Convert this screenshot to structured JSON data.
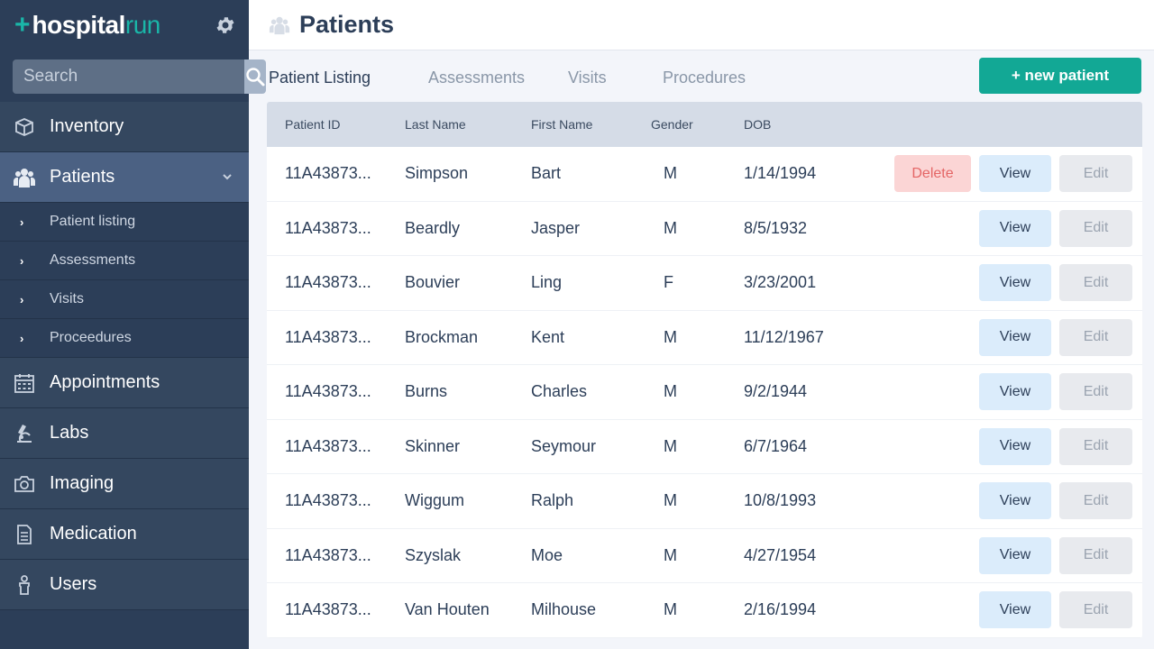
{
  "brand": {
    "plus": "+",
    "name_a": "hospital",
    "name_b": "run"
  },
  "search": {
    "placeholder": "Search"
  },
  "nav": {
    "items": [
      {
        "label": "Inventory",
        "icon": "box-icon"
      },
      {
        "label": "Patients",
        "icon": "patients-icon",
        "active": true
      },
      {
        "label": "Appointments",
        "icon": "calendar-icon"
      },
      {
        "label": "Labs",
        "icon": "microscope-icon"
      },
      {
        "label": "Imaging",
        "icon": "camera-icon"
      },
      {
        "label": "Medication",
        "icon": "document-icon"
      },
      {
        "label": "Users",
        "icon": "user-icon"
      }
    ],
    "sub_items": [
      "Patient listing",
      "Assessments",
      "Visits",
      "Proceedures"
    ]
  },
  "header": {
    "title": "Patients"
  },
  "tabs": [
    "Patient Listing",
    "Assessments",
    "Visits",
    "Procedures"
  ],
  "new_patient_label": "+ new patient",
  "table": {
    "columns": [
      "Patient ID",
      "Last Name",
      "First Name",
      "Gender",
      "DOB"
    ],
    "rows": [
      {
        "id": "11A43873...",
        "last": "Simpson",
        "first": "Bart",
        "gender": "M",
        "dob": "1/14/1994",
        "delete": true
      },
      {
        "id": "11A43873...",
        "last": "Beardly",
        "first": "Jasper",
        "gender": "M",
        "dob": "8/5/1932"
      },
      {
        "id": "11A43873...",
        "last": "Bouvier",
        "first": "Ling",
        "gender": "F",
        "dob": "3/23/2001"
      },
      {
        "id": "11A43873...",
        "last": "Brockman",
        "first": "Kent",
        "gender": "M",
        "dob": "11/12/1967"
      },
      {
        "id": "11A43873...",
        "last": "Burns",
        "first": "Charles",
        "gender": "M",
        "dob": "9/2/1944"
      },
      {
        "id": "11A43873...",
        "last": "Skinner",
        "first": "Seymour",
        "gender": "M",
        "dob": "6/7/1964"
      },
      {
        "id": "11A43873...",
        "last": "Wiggum",
        "first": "Ralph",
        "gender": "M",
        "dob": "10/8/1993"
      },
      {
        "id": "11A43873...",
        "last": "Szyslak",
        "first": "Moe",
        "gender": "M",
        "dob": "4/27/1954"
      },
      {
        "id": "11A43873...",
        "last": "Van Houten",
        "first": "Milhouse",
        "gender": "M",
        "dob": "2/16/1994"
      }
    ],
    "delete_label": "Delete",
    "view_label": "View",
    "edit_label": "Edit"
  },
  "colors": {
    "sidebar": "#2c3e58",
    "accent": "#12a895",
    "brand_teal": "#1ab6a8",
    "active_nav": "#4b6183"
  }
}
